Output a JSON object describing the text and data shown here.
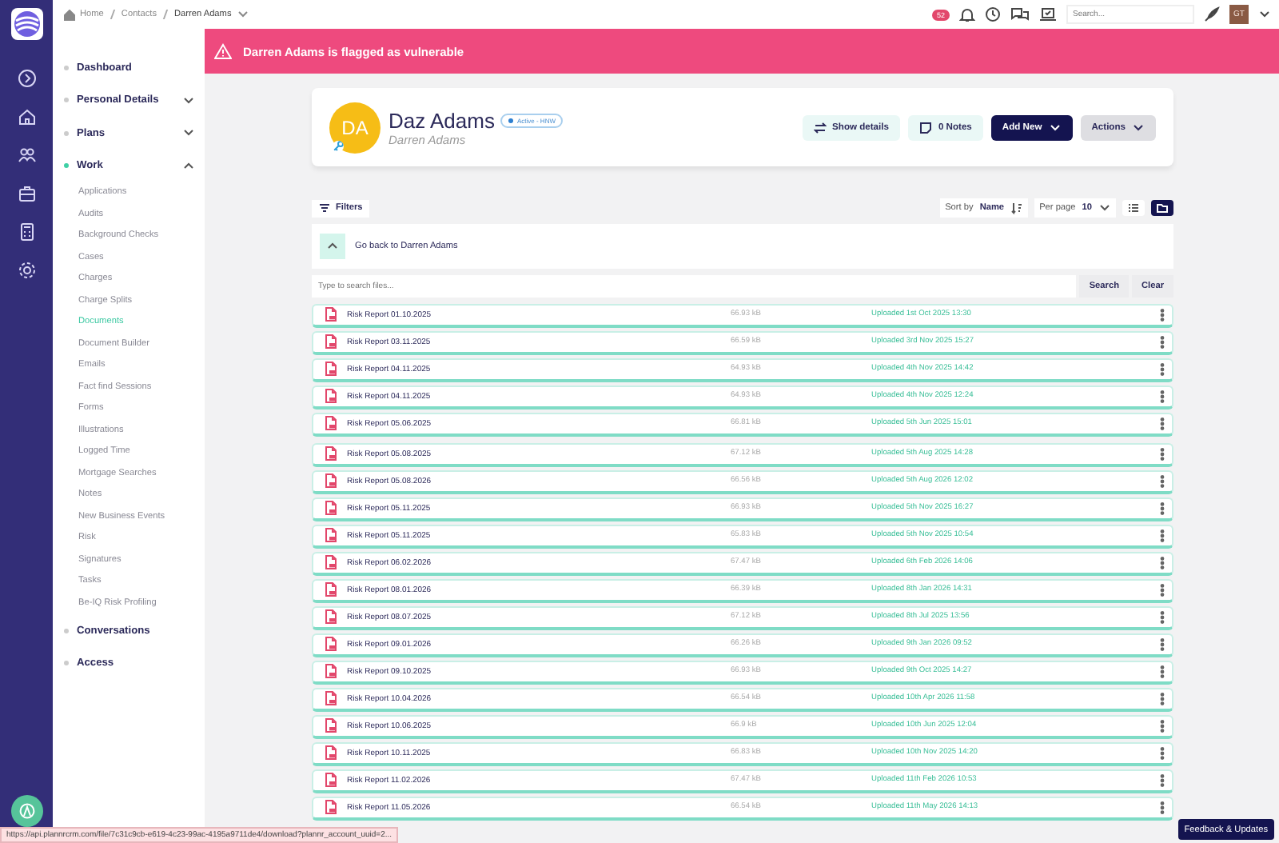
{
  "breadcrumb": [
    {
      "label": "Home",
      "kind": "home"
    },
    {
      "label": "Contacts",
      "kind": "link"
    },
    {
      "label": "Darren Adams",
      "kind": "current"
    }
  ],
  "topbar": {
    "badge": "52",
    "search_placeholder": "Search...",
    "user_initials": "GT"
  },
  "sidebar": {
    "sections": [
      {
        "label": "Dashboard",
        "selected": false
      },
      {
        "label": "Personal Details",
        "selected": false,
        "expanded": false
      },
      {
        "label": "Plans",
        "selected": false,
        "expanded": false
      },
      {
        "label": "Work",
        "selected": true,
        "expanded": true,
        "children": [
          {
            "label": "Applications",
            "selected": false
          },
          {
            "label": "Audits",
            "selected": false
          },
          {
            "label": "Background Checks",
            "selected": false
          },
          {
            "label": "Cases",
            "selected": false
          },
          {
            "label": "Charges",
            "selected": false
          },
          {
            "label": "Charge Splits",
            "selected": false
          },
          {
            "label": "Documents",
            "selected": true
          },
          {
            "label": "Document Builder",
            "selected": false
          },
          {
            "label": "Emails",
            "selected": false
          },
          {
            "label": "Fact find Sessions",
            "selected": false
          },
          {
            "label": "Forms",
            "selected": false
          },
          {
            "label": "Illustrations",
            "selected": false
          },
          {
            "label": "Logged Time",
            "selected": false
          },
          {
            "label": "Mortgage Searches",
            "selected": false
          },
          {
            "label": "Notes",
            "selected": false
          },
          {
            "label": "New Business Events",
            "selected": false
          },
          {
            "label": "Risk",
            "selected": false
          },
          {
            "label": "Signatures",
            "selected": false
          },
          {
            "label": "Tasks",
            "selected": false
          },
          {
            "label": "Be-IQ Risk Profiling",
            "selected": false
          }
        ]
      },
      {
        "label": "Conversations",
        "selected": false
      },
      {
        "label": "Access",
        "selected": false
      }
    ]
  },
  "banner": {
    "text": "Darren Adams is flagged as vulnerable"
  },
  "contact": {
    "initials": "DA",
    "name": "Daz Adams",
    "status": "Active - HNW",
    "full_name": "Darren Adams",
    "buttons": [
      {
        "label": "Show details",
        "kind": "details"
      },
      {
        "label": "0 Notes",
        "kind": "notes"
      },
      {
        "label": "Add New",
        "kind": "primary"
      },
      {
        "label": "Actions",
        "kind": "menu"
      }
    ]
  },
  "toolbar": {
    "filters": "Filters",
    "sort_label": "Sort by",
    "sort_value": "Name",
    "per_page_label": "Per page",
    "per_page_value": "10",
    "views": [
      {
        "kind": "list",
        "selected": false
      },
      {
        "kind": "folder",
        "selected": true
      }
    ]
  },
  "go_back": "Go back to Darren Adams",
  "search": {
    "placeholder": "Type to search files...",
    "search_button": "Search",
    "clear_button": "Clear"
  },
  "documents": [
    {
      "name": "Risk Report 01.10.2025",
      "size": "66.93 kB",
      "uploaded": "Uploaded 1st Oct 2025 13:30"
    },
    {
      "name": "Risk Report 03.11.2025",
      "size": "66.59 kB",
      "uploaded": "Uploaded 3rd Nov 2025 15:27"
    },
    {
      "name": "Risk Report 04.11.2025",
      "size": "64.93 kB",
      "uploaded": "Uploaded 4th Nov 2025 14:42"
    },
    {
      "name": "Risk Report 04.11.2025",
      "size": "64.93 kB",
      "uploaded": "Uploaded 4th Nov 2025 12:24"
    },
    {
      "name": "Risk Report 05.06.2025",
      "size": "66.81 kB",
      "uploaded": "Uploaded 5th Jun 2025 15:01"
    },
    {
      "name": "Risk Report 05.08.2025",
      "size": "67.12 kB",
      "uploaded": "Uploaded 5th Aug 2025 14:28"
    },
    {
      "name": "Risk Report 05.08.2026",
      "size": "66.56 kB",
      "uploaded": "Uploaded 5th Aug 2026 12:02"
    },
    {
      "name": "Risk Report 05.11.2025",
      "size": "66.93 kB",
      "uploaded": "Uploaded 5th Nov 2025 16:27"
    },
    {
      "name": "Risk Report 05.11.2025",
      "size": "65.83 kB",
      "uploaded": "Uploaded 5th Nov 2025 10:54"
    },
    {
      "name": "Risk Report 06.02.2026",
      "size": "67.47 kB",
      "uploaded": "Uploaded 6th Feb 2026 14:06"
    },
    {
      "name": "Risk Report 08.01.2026",
      "size": "66.39 kB",
      "uploaded": "Uploaded 8th Jan 2026 14:31"
    },
    {
      "name": "Risk Report 08.07.2025",
      "size": "67.12 kB",
      "uploaded": "Uploaded 8th Jul 2025 13:56"
    },
    {
      "name": "Risk Report 09.01.2026",
      "size": "66.26 kB",
      "uploaded": "Uploaded 9th Jan 2026 09:52"
    },
    {
      "name": "Risk Report 09.10.2025",
      "size": "66.93 kB",
      "uploaded": "Uploaded 9th Oct 2025 14:27"
    },
    {
      "name": "Risk Report 10.04.2026",
      "size": "66.54 kB",
      "uploaded": "Uploaded 10th Apr 2026 11:58"
    },
    {
      "name": "Risk Report 10.06.2025",
      "size": "66.9 kB",
      "uploaded": "Uploaded 10th Jun 2025 12:04"
    },
    {
      "name": "Risk Report 10.11.2025",
      "size": "66.83 kB",
      "uploaded": "Uploaded 10th Nov 2025 14:20"
    },
    {
      "name": "Risk Report 11.02.2026",
      "size": "67.47 kB",
      "uploaded": "Uploaded 11th Feb 2026 10:53"
    },
    {
      "name": "Risk Report 11.05.2026",
      "size": "66.54 kB",
      "uploaded": "Uploaded 11th May 2026 14:13"
    }
  ],
  "status_bar": {
    "url": "https://api.plannrcrm.com/file/7c31c9cb-e619-4c23-99ac-4195a9711de4/download?plannr_account_uuid=2..."
  },
  "feedback_button": "Feedback & Updates"
}
